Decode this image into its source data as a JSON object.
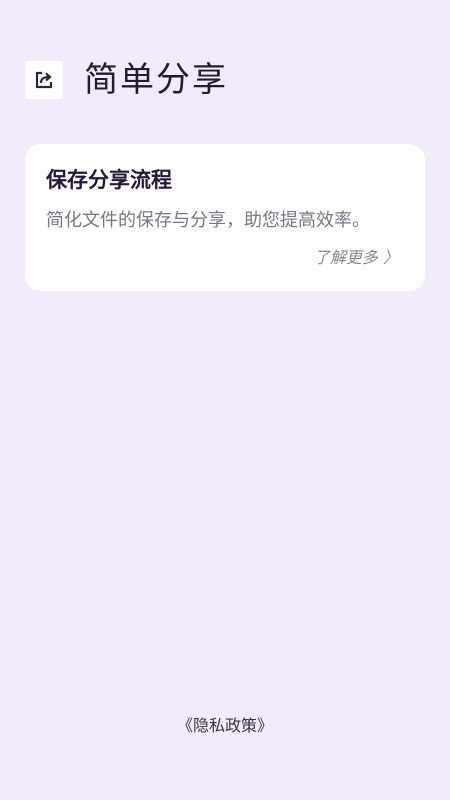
{
  "header": {
    "icon": "share-icon",
    "title": "简单分享"
  },
  "card": {
    "title": "保存分享流程",
    "description": "简化文件的保存与分享，助您提高效率。",
    "link_label": "了解更多 〉"
  },
  "footer": {
    "privacy_label": "《隐私政策》"
  },
  "colors": {
    "background": "#f1ebfc",
    "card": "#ffffff",
    "title": "#231a36"
  }
}
